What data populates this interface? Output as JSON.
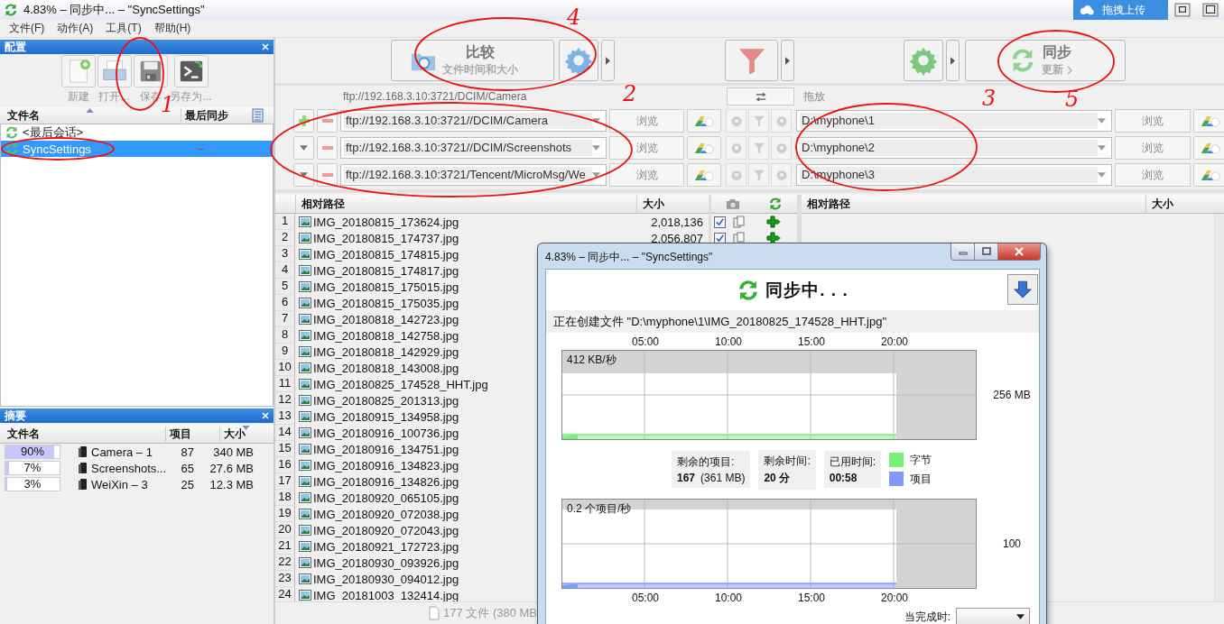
{
  "window": {
    "title": "4.83% – 同步中... – \"SyncSettings\""
  },
  "upload_widget": {
    "label": "拖拽上传"
  },
  "menu": [
    "文件(F)",
    "动作(A)",
    "工具(T)",
    "帮助(H)"
  ],
  "config_panel": {
    "title": "配置",
    "toolbar": [
      {
        "label": "新建",
        "kind": "new"
      },
      {
        "label": "打开...",
        "kind": "open"
      },
      {
        "label": "保存",
        "kind": "save"
      },
      {
        "label": "另存为...",
        "kind": "save_as"
      }
    ],
    "columns": [
      "文件名",
      "最后同步"
    ],
    "items": [
      {
        "name": "<最后会话>",
        "selected": false
      },
      {
        "name": "SyncSettings",
        "last_sync": "–",
        "selected": true
      }
    ]
  },
  "summary_panel": {
    "title": "摘要",
    "columns": [
      "文件名",
      "项目",
      "大小"
    ],
    "rows": [
      {
        "percent": "90%",
        "level": 0.9,
        "name": "Camera – 1",
        "items": "87",
        "size": "340 MB"
      },
      {
        "percent": "7%",
        "level": 0.07,
        "name": "Screenshots...",
        "items": "65",
        "size": "27.6 MB"
      },
      {
        "percent": "3%",
        "level": 0.03,
        "name": "WeiXin – 3",
        "items": "25",
        "size": "12.3 MB"
      }
    ]
  },
  "toolbar": {
    "compare": {
      "label": "比较",
      "sub": "文件时间和大小"
    },
    "sync": {
      "label": "同步",
      "sub": "更新"
    }
  },
  "folder_pairs": {
    "left_header": "ftp://192.168.3.10:3721/DCIM/Camera",
    "right_header": "拖放",
    "rows": [
      {
        "kind": "add",
        "left": "ftp://192.168.3.10:3721//DCIM/Camera",
        "left_browse": "浏览",
        "right": "D:\\myphone\\1",
        "right_browse": "浏览"
      },
      {
        "kind": "menu",
        "left": "ftp://192.168.3.10:3721//DCIM/Screenshots",
        "left_browse": "浏览",
        "right": "D:\\myphone\\2",
        "right_browse": "浏览"
      },
      {
        "kind": "menu",
        "left": "ftp://192.168.3.10:3721/Tencent/MicroMsg/We",
        "left_browse": "浏览",
        "right": "D:\\myphone\\3",
        "right_browse": "浏览"
      }
    ]
  },
  "grid": {
    "left_columns": [
      "相对路径",
      "大小"
    ],
    "right_columns": [
      "相对路径",
      "大小"
    ],
    "rows": [
      {
        "num": "1",
        "name": "IMG_20180815_173624.jpg",
        "size": "2,018,136",
        "checked": true
      },
      {
        "num": "2",
        "name": "IMG_20180815_174737.jpg",
        "size": "2,056,807",
        "checked": true
      },
      {
        "num": "3",
        "name": "IMG_20180815_174815.jpg"
      },
      {
        "num": "4",
        "name": "IMG_20180815_174817.jpg"
      },
      {
        "num": "5",
        "name": "IMG_20180815_175015.jpg"
      },
      {
        "num": "6",
        "name": "IMG_20180815_175035.jpg"
      },
      {
        "num": "7",
        "name": "IMG_20180818_142723.jpg"
      },
      {
        "num": "8",
        "name": "IMG_20180818_142758.jpg"
      },
      {
        "num": "9",
        "name": "IMG_20180818_142929.jpg"
      },
      {
        "num": "10",
        "name": "IMG_20180818_143008.jpg"
      },
      {
        "num": "11",
        "name": "IMG_20180825_174528_HHT.jpg"
      },
      {
        "num": "12",
        "name": "IMG_20180825_201313.jpg"
      },
      {
        "num": "13",
        "name": "IMG_20180915_134958.jpg"
      },
      {
        "num": "14",
        "name": "IMG_20180916_100736.jpg"
      },
      {
        "num": "15",
        "name": "IMG_20180916_134751.jpg"
      },
      {
        "num": "16",
        "name": "IMG_20180916_134823.jpg"
      },
      {
        "num": "17",
        "name": "IMG_20180916_134826.jpg"
      },
      {
        "num": "18",
        "name": "IMG_20180920_065105.jpg"
      },
      {
        "num": "19",
        "name": "IMG_20180920_072038.jpg"
      },
      {
        "num": "20",
        "name": "IMG_20180920_072043.jpg"
      },
      {
        "num": "21",
        "name": "IMG_20180921_172723.jpg"
      },
      {
        "num": "22",
        "name": "IMG_20180930_093926.jpg"
      },
      {
        "num": "23",
        "name": "IMG_20180930_094012.jpg"
      },
      {
        "num": "24",
        "name": "IMG_20181003_132414.jpg"
      }
    ]
  },
  "status_bar": {
    "summary": "177 文件 (380 MB"
  },
  "dialog": {
    "title": "4.83% – 同步中... – \"SyncSettings\"",
    "heading": "同步中. . .",
    "status": "正在创建文件 \"D:\\myphone\\1\\IMG_20180825_174528_HHT.jpg\"",
    "top_ticks": [
      "05:00",
      "10:00",
      "15:00",
      "20:00"
    ],
    "graphs": [
      {
        "rate": "412 KB/秒",
        "scale": "256 MB"
      },
      {
        "rate": "0.2 个项目/秒",
        "scale": "100"
      }
    ],
    "stats": [
      {
        "label": "剩余的项目:",
        "value": "167",
        "extra": "(361 MB)"
      },
      {
        "label": "剩余时间:",
        "value": "20 分"
      },
      {
        "label": "已用时间:",
        "value": "00:58"
      }
    ],
    "legend": [
      {
        "label": "字节",
        "color": "#77f077"
      },
      {
        "label": "项目",
        "color": "#8099ff"
      }
    ],
    "bottom_ticks": [
      "05:00",
      "10:00",
      "15:00",
      "20:00"
    ],
    "finish_label": "当完成时:"
  },
  "annotations": [
    {
      "label": "1"
    },
    {
      "label": "2"
    },
    {
      "label": "3"
    },
    {
      "label": "4"
    },
    {
      "label": "5"
    }
  ]
}
